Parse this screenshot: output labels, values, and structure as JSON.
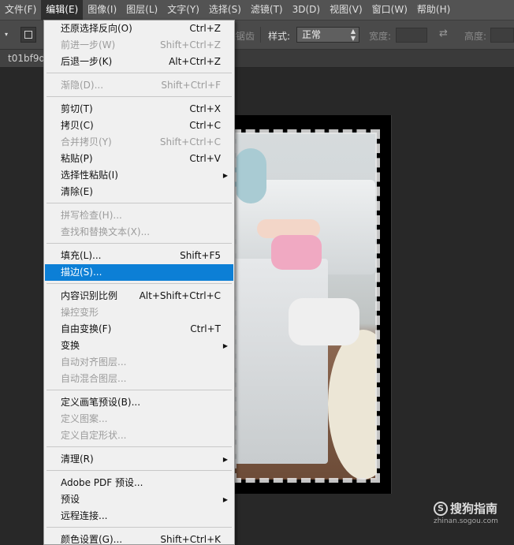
{
  "menubar": {
    "items": [
      "文件(F)",
      "编辑(E)",
      "图像(I)",
      "图层(L)",
      "文字(Y)",
      "选择(S)",
      "滤镜(T)",
      "3D(D)",
      "视图(V)",
      "窗口(W)",
      "帮助(H)"
    ]
  },
  "options": {
    "feather_fragment": "消除锯齿",
    "style_label": "样式:",
    "style_value": "正常",
    "width_label": "宽度:",
    "height_label": "高度:"
  },
  "document": {
    "tab_name": "t01bf9d"
  },
  "edit_menu": {
    "items": [
      {
        "label": "还原选择反向(O)",
        "shortcut": "Ctrl+Z"
      },
      {
        "label": "前进一步(W)",
        "shortcut": "Shift+Ctrl+Z",
        "disabled": true
      },
      {
        "label": "后退一步(K)",
        "shortcut": "Alt+Ctrl+Z"
      },
      {
        "label": "渐隐(D)...",
        "shortcut": "Shift+Ctrl+F",
        "disabled": true
      },
      {
        "label": "剪切(T)",
        "shortcut": "Ctrl+X"
      },
      {
        "label": "拷贝(C)",
        "shortcut": "Ctrl+C"
      },
      {
        "label": "合并拷贝(Y)",
        "shortcut": "Shift+Ctrl+C",
        "disabled": true
      },
      {
        "label": "粘贴(P)",
        "shortcut": "Ctrl+V"
      },
      {
        "label": "选择性粘贴(I)",
        "shortcut": "",
        "submenu": true
      },
      {
        "label": "清除(E)",
        "shortcut": ""
      },
      {
        "label": "拼写检查(H)...",
        "shortcut": "",
        "disabled": true
      },
      {
        "label": "查找和替换文本(X)...",
        "shortcut": "",
        "disabled": true
      },
      {
        "label": "填充(L)...",
        "shortcut": "Shift+F5"
      },
      {
        "label": "描边(S)...",
        "shortcut": "",
        "highlighted": true
      },
      {
        "label": "内容识别比例",
        "shortcut": "Alt+Shift+Ctrl+C"
      },
      {
        "label": "操控变形",
        "shortcut": "",
        "disabled": true
      },
      {
        "label": "自由变换(F)",
        "shortcut": "Ctrl+T"
      },
      {
        "label": "变换",
        "shortcut": "",
        "submenu": true
      },
      {
        "label": "自动对齐图层...",
        "shortcut": "",
        "disabled": true
      },
      {
        "label": "自动混合图层...",
        "shortcut": "",
        "disabled": true
      },
      {
        "label": "定义画笔预设(B)...",
        "shortcut": ""
      },
      {
        "label": "定义图案...",
        "shortcut": "",
        "disabled": true
      },
      {
        "label": "定义自定形状...",
        "shortcut": "",
        "disabled": true
      },
      {
        "label": "清理(R)",
        "shortcut": "",
        "submenu": true
      },
      {
        "label": "Adobe PDF 预设...",
        "shortcut": ""
      },
      {
        "label": "预设",
        "shortcut": "",
        "submenu": true
      },
      {
        "label": "远程连接...",
        "shortcut": ""
      },
      {
        "label": "颜色设置(G)...",
        "shortcut": "Shift+Ctrl+K"
      }
    ]
  },
  "watermark": {
    "brand": "搜狗指南",
    "url": "zhinan.sogou.com",
    "logo_letter": "S"
  }
}
